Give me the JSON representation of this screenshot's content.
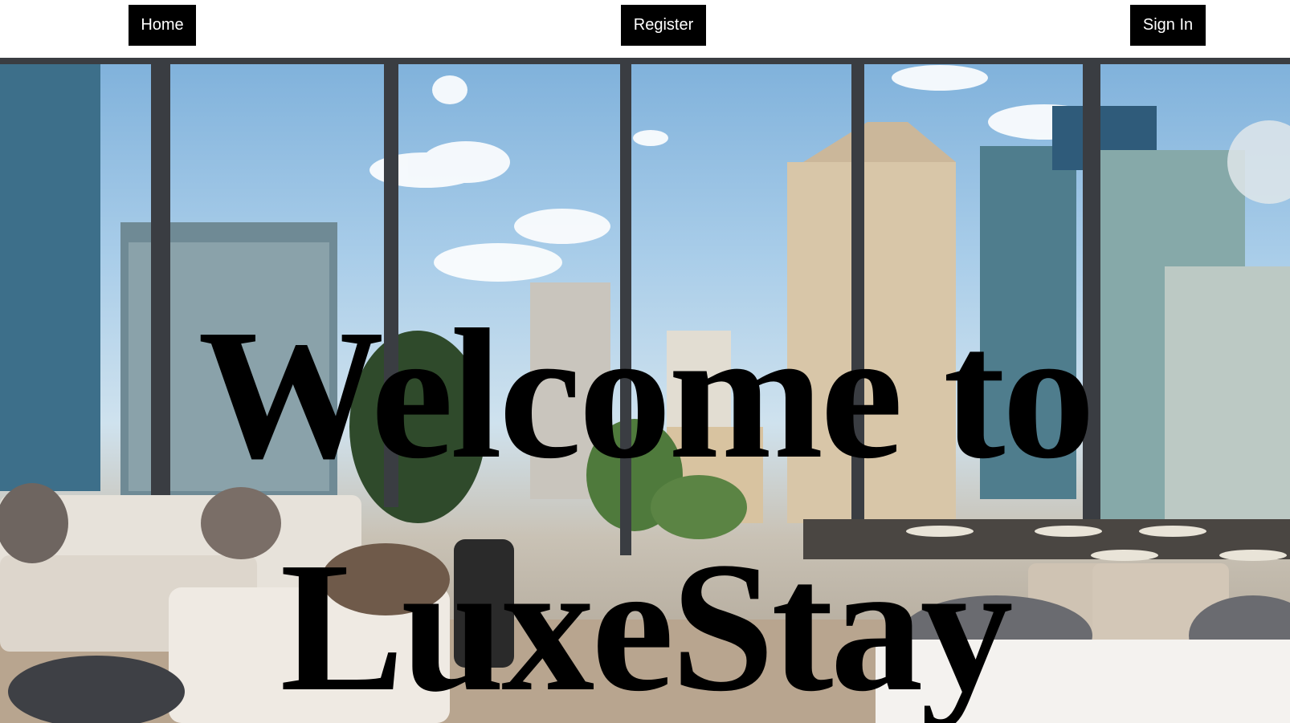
{
  "nav": {
    "home_label": "Home",
    "register_label": "Register",
    "signin_label": "Sign In"
  },
  "hero": {
    "headline": "Welcome to LuxeStay",
    "image_subject": "penthouse living room with floor-to-ceiling windows and city skyline"
  },
  "colors": {
    "button_bg": "#000000",
    "button_text": "#ffffff",
    "headline": "#000000",
    "nav_bg": "#ffffff"
  }
}
